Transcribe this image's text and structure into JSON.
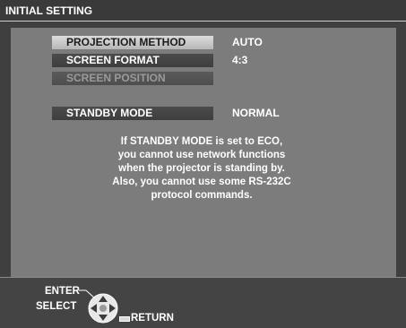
{
  "title": "INITIAL SETTING",
  "menu": {
    "items": [
      {
        "label": "PROJECTION METHOD",
        "value": "AUTO"
      },
      {
        "label": "SCREEN FORMAT",
        "value": "4:3"
      },
      {
        "label": "SCREEN POSITION",
        "value": ""
      },
      {
        "label": "STANDBY MODE",
        "value": "NORMAL"
      }
    ]
  },
  "message": {
    "lines": [
      "If STANDBY MODE is set to ECO,",
      "you cannot use network functions",
      "when the projector is standing by.",
      "Also, you cannot use some RS-232C",
      "protocol commands."
    ]
  },
  "footer": {
    "enter_label": "ENTER",
    "select_label": "SELECT",
    "return_label": "RETURN"
  },
  "icons": {
    "dpad": "dpad-icon",
    "return": "return-button-icon"
  },
  "colors": {
    "panel": "#7c7c7c",
    "frame": "#3f3f3f",
    "selected": "#d0d0d0"
  }
}
